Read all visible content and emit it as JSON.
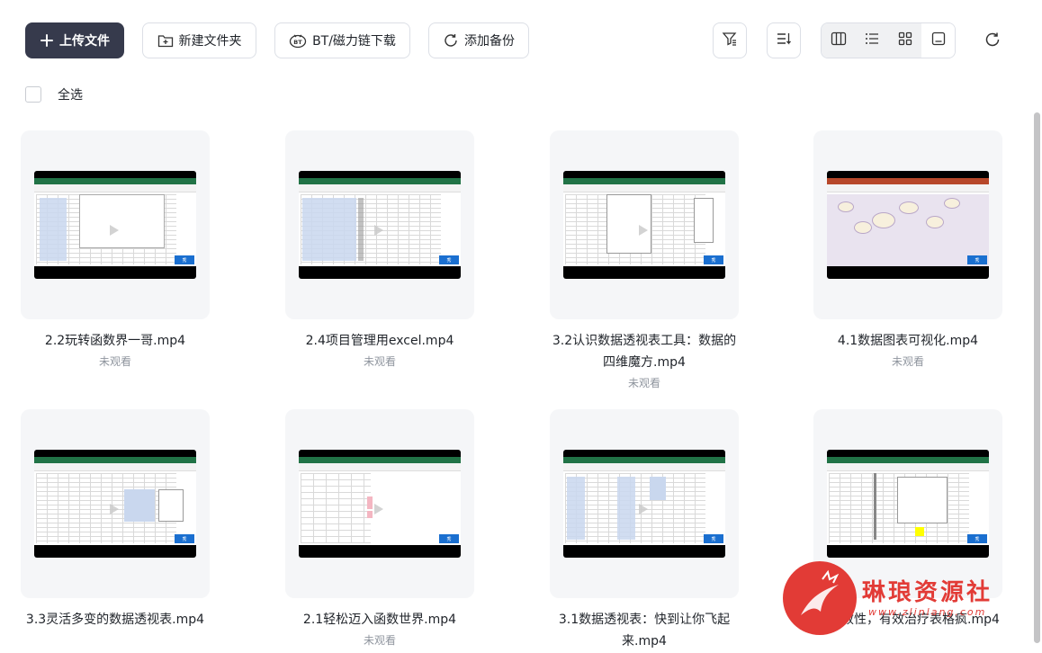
{
  "toolbar": {
    "upload_label": "上传文件",
    "new_folder_label": "新建文件夹",
    "bt_label": "BT/磁力链下载",
    "backup_label": "添加备份"
  },
  "select_all_label": "全选",
  "files": [
    {
      "name": "2.2玩转函数界一哥.mp4",
      "status": "未观看"
    },
    {
      "name": "2.4项目管理用excel.mp4",
      "status": "未观看"
    },
    {
      "name": "3.2认识数据透视表工具：数据的四维魔方.mp4",
      "status": "未观看"
    },
    {
      "name": "4.1数据图表可视化.mp4",
      "status": "未观看"
    },
    {
      "name": "3.3灵活多变的数据透视表.mp4",
      "status": ""
    },
    {
      "name": "2.1轻松迈入函数世界.mp4",
      "status": "未观看"
    },
    {
      "name": "3.1数据透视表：快到让你飞起来.mp4",
      "status": ""
    },
    {
      "name": "据有效性，有效治疗表格疯.mp4",
      "status": ""
    }
  ],
  "watermark": {
    "text": "琳琅资源社",
    "url": "www.zlinlang.com"
  },
  "thumb_logo": "秀",
  "colors": {
    "primary_button": "#363a4c",
    "excel_green": "#217346",
    "watermark_red": "#e23b36"
  }
}
